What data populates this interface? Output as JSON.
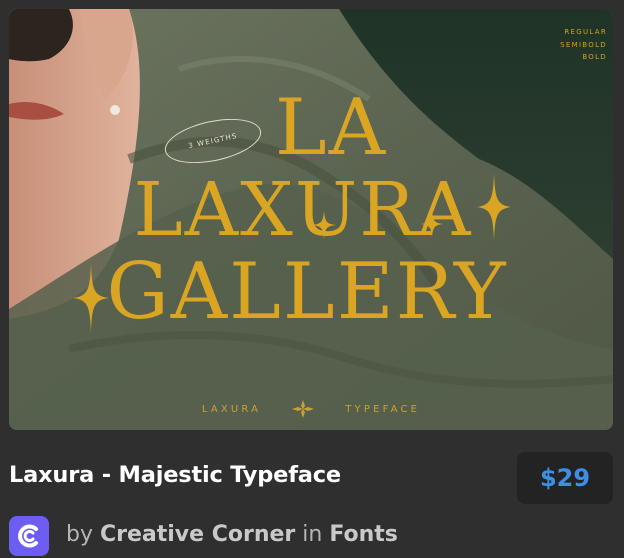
{
  "image": {
    "weights": [
      "REGULAR",
      "SEMIBOLD",
      "BOLD"
    ],
    "badge_text": "3 WEIGTHS",
    "title_lines": [
      "LA",
      "LAXURA",
      "GALLERY"
    ],
    "bottom_left": "LAXURA",
    "bottom_right": "TYPEFACE",
    "accent_color": "#d9a523"
  },
  "product": {
    "title": "Laxura - Majestic Typeface",
    "price": "$29",
    "price_color": "#3d8fe6"
  },
  "byline": {
    "by": "by",
    "shop": "Creative Corner",
    "in": "in",
    "category": "Fonts",
    "avatar_icon": "creative-corner-logo-icon",
    "avatar_color": "#6d5df2"
  }
}
